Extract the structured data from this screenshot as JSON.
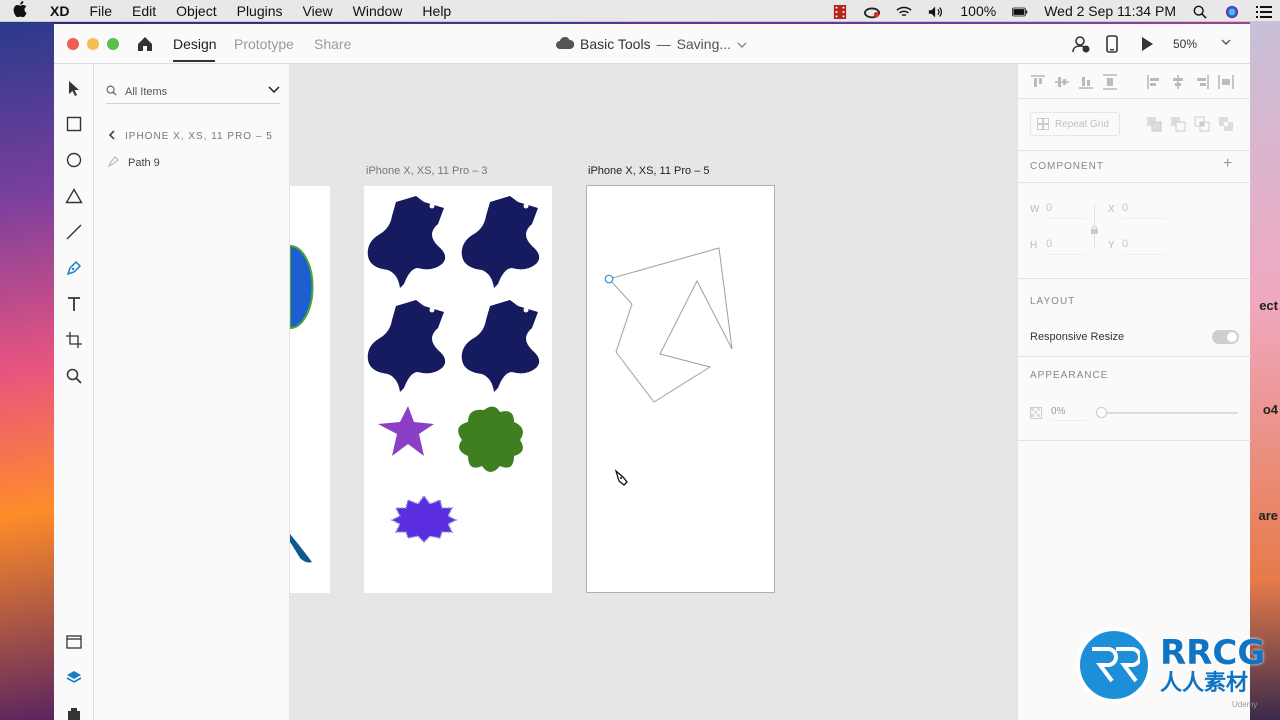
{
  "menubar": {
    "apple_icon": "apple-icon",
    "app_name": "XD",
    "items": [
      "File",
      "Edit",
      "Object",
      "Plugins",
      "View",
      "Window",
      "Help"
    ],
    "battery": "100%",
    "datetime": "Wed 2 Sep  11:34 PM"
  },
  "titlebar": {
    "tabs": {
      "design": "Design",
      "prototype": "Prototype",
      "share": "Share"
    },
    "doc_name": "Basic Tools",
    "separator": "—",
    "doc_status": "Saving...",
    "zoom": "50%"
  },
  "layers": {
    "search_label": "All Items",
    "breadcrumb": "IPHONE X, XS, 11 PRO – 5",
    "item": "Path 9"
  },
  "canvas": {
    "artboard_3_label": "iPhone X, XS, 11 Pro – 3",
    "artboard_5_label": "iPhone X, XS, 11 Pro – 5"
  },
  "props": {
    "repeat_grid": "Repeat Grid",
    "component_title": "COMPONENT",
    "w_label": "W",
    "w_value": "0",
    "h_label": "H",
    "h_value": "0",
    "x_label": "X",
    "x_value": "0",
    "y_label": "Y",
    "y_value": "0",
    "layout_title": "LAYOUT",
    "responsive_resize": "Responsive Resize",
    "responsive_resize_on": true,
    "appearance_title": "APPEARANCE",
    "opacity": "0%"
  },
  "desktop_fragments": {
    "a": "ect",
    "b": "o4",
    "c": "are"
  },
  "watermark": {
    "logo": "RRCG",
    "sub": "人人素材",
    "udemy": "Udemy"
  },
  "colors": {
    "navy_shape": "#161a5e",
    "purple_star": "#8a3fc6",
    "green_star": "#3f7f1f",
    "blue_blob": "#5a2ee0",
    "accent": "#1d8fd8"
  }
}
